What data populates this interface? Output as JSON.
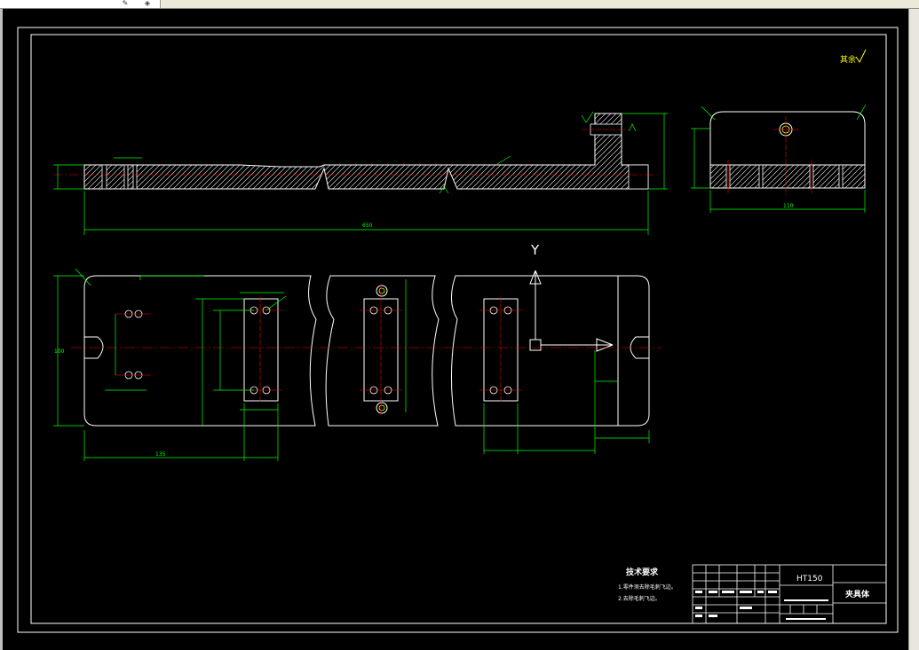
{
  "window": {
    "toolbar_icons": [
      "pencil-icon",
      "shield-icon"
    ]
  },
  "drawing": {
    "roughness_note": "其余",
    "material": "HT150",
    "part_name": "夹具体",
    "tech_req_title": "技术要求",
    "tech_req_items": [
      "1.零件须去除毛刺飞边。",
      "2.去除毛刺飞边。"
    ],
    "axis_y_label": "Y",
    "dim_overall_length": "650",
    "dim_side_width": "110",
    "dim_plan_height": "100",
    "dim_plan_offset": "135"
  },
  "colors": {
    "outline": "#ffffff",
    "dimension": "#00ff00",
    "centerline": "#ff0000",
    "background": "#000000"
  }
}
